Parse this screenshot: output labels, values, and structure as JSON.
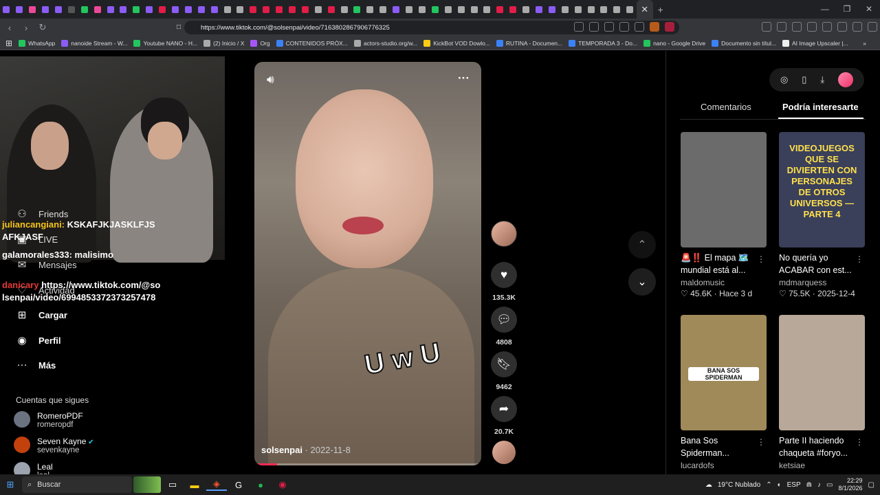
{
  "browser": {
    "tab_colors": [
      "#8b5cf6",
      "#8b5cf6",
      "#ec4899",
      "#8b5cf6",
      "#8b5cf6",
      "#555",
      "#22c55e",
      "#ec4899",
      "#8b5cf6",
      "#8b5cf6",
      "#22c55e",
      "#8b5cf6",
      "#e11d48",
      "#8b5cf6",
      "#8b5cf6",
      "#8b5cf6",
      "#8b5cf6",
      "#aaa",
      "#aaa",
      "#e11d48",
      "#e11d48",
      "#e11d48",
      "#e11d48",
      "#e11d48",
      "#aaa",
      "#e11d48",
      "#aaa",
      "#22c55e",
      "#aaa",
      "#aaa",
      "#8b5cf6",
      "#aaa",
      "#aaa",
      "#22c55e",
      "#aaa",
      "#aaa",
      "#aaa",
      "#aaa",
      "#e11d48",
      "#e11d48",
      "#aaa",
      "#8b5cf6",
      "#8b5cf6",
      "#aaa",
      "#aaa",
      "#aaa",
      "#aaa",
      "#aaa",
      "#aaa"
    ],
    "active_tab_close": "✕",
    "new_tab": "+",
    "window_controls": [
      "—",
      "❐",
      "✕"
    ],
    "url": "https://www.tiktok.com/@solsenpai/video/7163802867906776325",
    "bookmarks": [
      {
        "label": "WhatsApp",
        "color": "#22c55e"
      },
      {
        "label": "nanoide Stream - W...",
        "color": "#8b5cf6"
      },
      {
        "label": "Youtube NANO - H...",
        "color": "#22c55e"
      },
      {
        "label": "(2) Inicio / X",
        "color": "#aaa"
      },
      {
        "label": "Org",
        "color": "#a855f7"
      },
      {
        "label": "CONTENIDOS PRÓX...",
        "color": "#3b82f6"
      },
      {
        "label": "actors-studio.org/w...",
        "color": "#aaa"
      },
      {
        "label": "KickBot VOD Dowlo...",
        "color": "#facc15"
      },
      {
        "label": "RUTINA - Documen...",
        "color": "#3b82f6"
      },
      {
        "label": "TEMPORADA 3 - Do...",
        "color": "#3b82f6"
      },
      {
        "label": "nano - Google Drive",
        "color": "#22c55e"
      },
      {
        "label": "Documento sin títul...",
        "color": "#3b82f6"
      },
      {
        "label": "AI Image Upscaler |...",
        "color": "#eee"
      }
    ]
  },
  "sidebar": {
    "nav": [
      {
        "icon": "⚇",
        "label": "Friends"
      },
      {
        "icon": "▣",
        "label": "LIVE"
      },
      {
        "icon": "✉",
        "label": "Mensajes"
      },
      {
        "icon": "♡",
        "label": "Actividad"
      },
      {
        "icon": "⊞",
        "label": "Cargar"
      },
      {
        "icon": "◉",
        "label": "Perfil"
      },
      {
        "icon": "···",
        "label": "Más"
      }
    ],
    "following_title": "Cuentas que sigues",
    "following": [
      {
        "name": "RomeroPDF",
        "handle": "romeropdf",
        "verified": false,
        "color": "#6b7280"
      },
      {
        "name": "Seven Kayne",
        "handle": "sevenkayne",
        "verified": true,
        "color": "#c2410c"
      },
      {
        "name": "Leal",
        "handle": "leal",
        "verified": false,
        "color": "#9ca3af"
      }
    ]
  },
  "chat": [
    {
      "user": "juliancangiani:",
      "text": "KSKAFJKJASKLFJS AFKJASF",
      "color": "#f5c518"
    },
    {
      "user": "galamorales333:",
      "text": "malisimo",
      "color": "#fff"
    },
    {
      "user": "danicary",
      "text": "https://www.tiktok.com/@solsenpai/video/6994853372373257478",
      "color": "#e53935"
    }
  ],
  "video": {
    "author": "solsenpai",
    "date": "2022-11-8",
    "overlay_text": "U w U",
    "progress": 0.1,
    "likes": "135.3K",
    "comments": "4808",
    "saves": "9462",
    "shares": "20.7K"
  },
  "right_panel": {
    "tabs": [
      "Comentarios",
      "Podría interesarte"
    ],
    "active_tab": 1,
    "cards": [
      {
        "title": "🚨‼️ El mapa 🗺️ mundial está al...",
        "author": "maldomusic",
        "likes": "45.6K",
        "date": "Hace 3 d",
        "thumb_color": "#6b6b6b",
        "thumb_text": ""
      },
      {
        "title": "No quería yo ACABAR con est...",
        "author": "mdmarquess",
        "likes": "75.5K",
        "date": "2025-12-4",
        "thumb_color": "#3a3f5a",
        "thumb_text": "VIDEOJUEGOS QUE SE DIVIERTEN CON PERSONAJES DE OTROS UNIVERSOS — PARTE 4"
      },
      {
        "title": "Bana Sos Spiderman...",
        "author": "lucardofs",
        "likes": "",
        "date": "",
        "thumb_color": "#a08a5a",
        "thumb_text": "BANA SOS SPIDERMAN"
      },
      {
        "title": "Parte II haciendo chaqueta #foryo...",
        "author": "ketsiae",
        "likes": "",
        "date": "",
        "thumb_color": "#b8a89a",
        "thumb_text": ""
      }
    ]
  },
  "taskbar": {
    "search_label": "Buscar",
    "weather": "19°C  Nublado",
    "language": "ESP",
    "time": "22:29",
    "date": "8/1/2026"
  }
}
